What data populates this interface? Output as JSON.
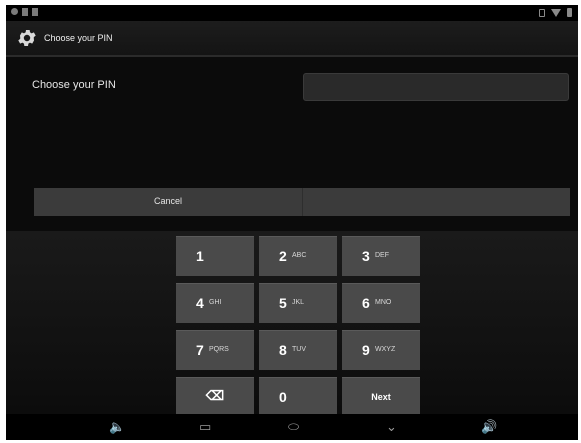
{
  "status_bar": {},
  "action_bar": {
    "title": "Choose your PIN",
    "icon": "gear-icon"
  },
  "main": {
    "pin_label": "Choose your PIN",
    "pin_value": "",
    "cancel_label": "Cancel"
  },
  "keypad": {
    "keys": [
      {
        "num": "1",
        "letters": ""
      },
      {
        "num": "2",
        "letters": "ABC"
      },
      {
        "num": "3",
        "letters": "DEF"
      },
      {
        "num": "4",
        "letters": "GHI"
      },
      {
        "num": "5",
        "letters": "JKL"
      },
      {
        "num": "6",
        "letters": "MNO"
      },
      {
        "num": "7",
        "letters": "PQRS"
      },
      {
        "num": "8",
        "letters": "TUV"
      },
      {
        "num": "9",
        "letters": "WXYZ"
      },
      {
        "num": "⌫",
        "letters": ""
      },
      {
        "num": "0",
        "letters": ""
      },
      {
        "num": "Next",
        "letters": ""
      }
    ]
  },
  "nav_bar": {
    "volume_down": "🔈",
    "back": "⬭",
    "home": "⌂",
    "recent": "▭",
    "down": "⌄",
    "volume_up": "🔊"
  }
}
